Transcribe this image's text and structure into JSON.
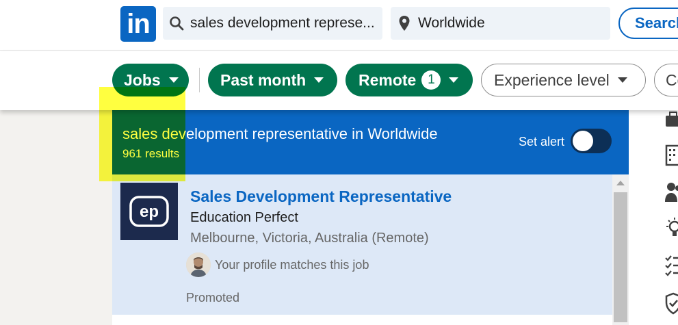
{
  "header": {
    "logo_text": "in",
    "keyword_value": "sales development represe...",
    "location_value": "Worldwide",
    "search_label": "Search"
  },
  "filters": [
    {
      "label": "Jobs",
      "active": true
    },
    {
      "label": "Past month",
      "active": true
    },
    {
      "label": "Remote",
      "active": true,
      "count": "1"
    },
    {
      "label": "Experience level",
      "active": false
    },
    {
      "label": "Co",
      "active": false
    }
  ],
  "results": {
    "title": "sales development representative in Worldwide",
    "count": "961 results",
    "alert_label": "Set alert",
    "alert_on": false
  },
  "job": {
    "logo_text": "ep",
    "title": "Sales Development Representative",
    "company": "Education Perfect",
    "location": "Melbourne, Victoria, Australia (Remote)",
    "match": "Your profile matches this job",
    "promoted": "Promoted"
  },
  "colors": {
    "brand": "#0a66c2",
    "filter_green": "#01754f",
    "highlight": "#ffff00"
  },
  "rail_icons": [
    "briefcase-icon",
    "building-icon",
    "people-icon",
    "lightbulb-icon",
    "checklist-icon",
    "shield-check-icon"
  ]
}
